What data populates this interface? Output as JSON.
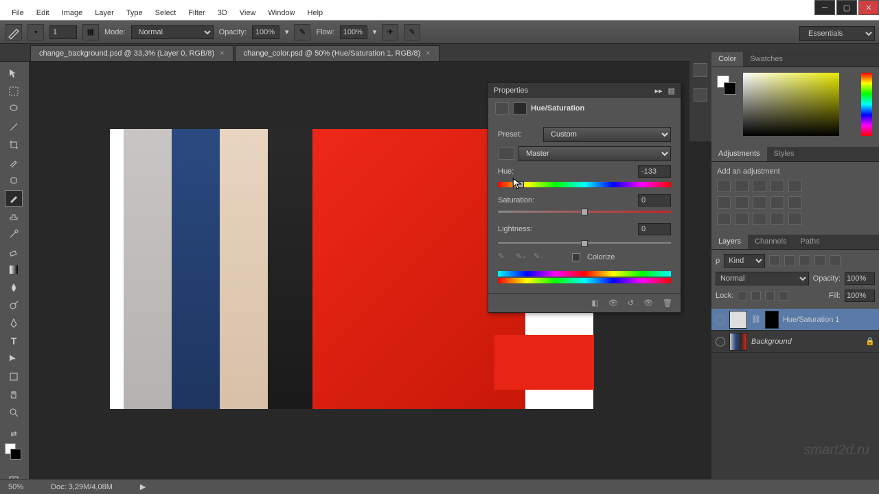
{
  "menu": [
    "File",
    "Edit",
    "Image",
    "Layer",
    "Type",
    "Select",
    "Filter",
    "3D",
    "View",
    "Window",
    "Help"
  ],
  "options": {
    "size": "1",
    "mode_label": "Mode:",
    "mode": "Normal",
    "opacity_label": "Opacity:",
    "opacity": "100%",
    "flow_label": "Flow:",
    "flow": "100%"
  },
  "workspace": "Essentials",
  "tabs": [
    {
      "label": "change_background.psd @ 33,3% (Layer 0, RGB/8)",
      "active": false
    },
    {
      "label": "change_color.psd @ 50% (Hue/Saturation 1, RGB/8)",
      "active": true
    }
  ],
  "properties": {
    "title": "Properties",
    "subtitle": "Hue/Saturation",
    "preset_label": "Preset:",
    "preset": "Custom",
    "channel": "Master",
    "hue_label": "Hue:",
    "hue": "-133",
    "sat_label": "Saturation:",
    "sat": "0",
    "light_label": "Lightness:",
    "light": "0",
    "colorize": "Colorize"
  },
  "panels": {
    "color": "Color",
    "swatches": "Swatches",
    "adjustments": "Adjustments",
    "styles": "Styles",
    "add_adjustment": "Add an adjustment",
    "layers": "Layers",
    "channels": "Channels",
    "paths": "Paths"
  },
  "layers_panel": {
    "kind": "Kind",
    "blend": "Normal",
    "opacity_label": "Opacity:",
    "opacity": "100%",
    "lock_label": "Lock:",
    "fill_label": "Fill:",
    "fill": "100%",
    "items": [
      {
        "name": "Hue/Saturation 1"
      },
      {
        "name": "Background"
      }
    ]
  },
  "status": {
    "zoom": "50%",
    "doc": "Doc: 3,29M/4,08M"
  },
  "watermark": "smart2d.ru"
}
